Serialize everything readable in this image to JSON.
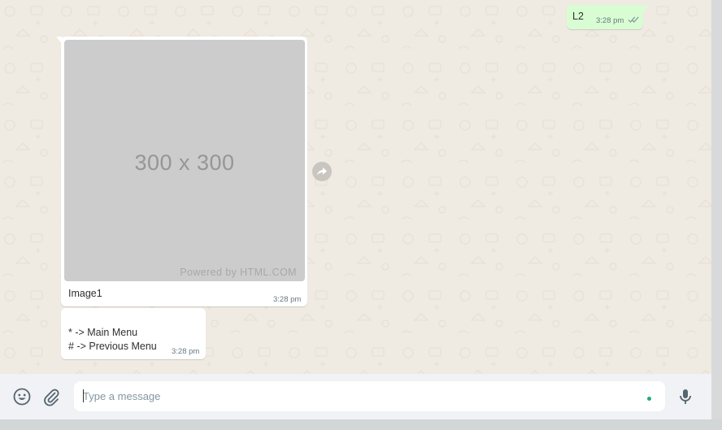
{
  "messages": {
    "outgoing": [
      {
        "text": "L2",
        "time": "3:28 pm",
        "status_icon": "double-check-icon"
      }
    ],
    "incoming_image": {
      "placeholder_dimensions": "300 x 300",
      "placeholder_watermark": "Powered by HTML.COM",
      "caption": "Image1",
      "time": "3:28 pm"
    },
    "incoming_menu": {
      "lines": [
        "* -> Main Menu",
        "# -> Previous Menu"
      ],
      "time": "3:28 pm"
    }
  },
  "actions": {
    "forward_icon": "forward-icon"
  },
  "composer": {
    "placeholder": "Type a message",
    "value": "",
    "emoji_icon": "emoji-icon",
    "attach_icon": "paperclip-icon",
    "mic_icon": "microphone-icon"
  },
  "colors": {
    "chat_background": "#efeae2",
    "outgoing_bubble": "#d9fdd3",
    "incoming_bubble": "#ffffff",
    "composer_background": "#f0f2f5",
    "timestamp": "#667781",
    "accent": "#25a884"
  }
}
